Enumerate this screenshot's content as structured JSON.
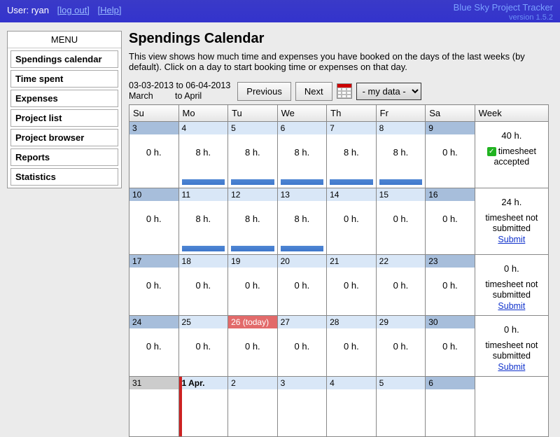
{
  "header": {
    "user_label": "User:",
    "user_name": "ryan",
    "logout": "[log out]",
    "help": "[Help]",
    "app_name": "Blue Sky Project Tracker",
    "version": "version 1.5.2"
  },
  "sidebar": {
    "title": "MENU",
    "items": [
      "Spendings calendar",
      "Time spent",
      "Expenses",
      "Project list",
      "Project browser",
      "Reports",
      "Statistics"
    ]
  },
  "page": {
    "title": "Spendings Calendar",
    "desc": "This view shows how much time and expenses you have booked on the days of the last weeks (by default). Click on a day to start booking time or expenses on that day.",
    "date_from": "03-03-2013",
    "date_to": "to 06-04-2013",
    "month_from": "March",
    "month_to": "to April",
    "prev_btn": "Previous",
    "next_btn": "Next",
    "selector": "- my data -"
  },
  "calendar": {
    "day_headers": [
      "Su",
      "Mo",
      "Tu",
      "We",
      "Th",
      "Fr",
      "Sa",
      "Week"
    ],
    "weeks": [
      {
        "days": [
          {
            "num": "3",
            "hours": "0 h.",
            "weekend": true
          },
          {
            "num": "4",
            "hours": "8 h.",
            "bar": true
          },
          {
            "num": "5",
            "hours": "8 h.",
            "bar": true
          },
          {
            "num": "6",
            "hours": "8 h.",
            "bar": true
          },
          {
            "num": "7",
            "hours": "8 h.",
            "bar": true
          },
          {
            "num": "8",
            "hours": "8 h.",
            "bar": true
          },
          {
            "num": "9",
            "hours": "0 h.",
            "weekend": true
          }
        ],
        "summary": {
          "hours": "40 h.",
          "status": "timesheet accepted",
          "accepted": true
        }
      },
      {
        "days": [
          {
            "num": "10",
            "hours": "0 h.",
            "weekend": true
          },
          {
            "num": "11",
            "hours": "8 h.",
            "bar": true
          },
          {
            "num": "12",
            "hours": "8 h.",
            "bar": true
          },
          {
            "num": "13",
            "hours": "8 h.",
            "bar": true
          },
          {
            "num": "14",
            "hours": "0 h."
          },
          {
            "num": "15",
            "hours": "0 h."
          },
          {
            "num": "16",
            "hours": "0 h.",
            "weekend": true
          }
        ],
        "summary": {
          "hours": "24 h.",
          "status": "timesheet not submitted",
          "submit": true
        }
      },
      {
        "days": [
          {
            "num": "17",
            "hours": "0 h.",
            "weekend": true
          },
          {
            "num": "18",
            "hours": "0 h."
          },
          {
            "num": "19",
            "hours": "0 h."
          },
          {
            "num": "20",
            "hours": "0 h."
          },
          {
            "num": "21",
            "hours": "0 h."
          },
          {
            "num": "22",
            "hours": "0 h."
          },
          {
            "num": "23",
            "hours": "0 h.",
            "weekend": true
          }
        ],
        "summary": {
          "hours": "0 h.",
          "status": "timesheet not submitted",
          "submit": true
        }
      },
      {
        "days": [
          {
            "num": "24",
            "hours": "0 h.",
            "weekend": true
          },
          {
            "num": "25",
            "hours": "0 h."
          },
          {
            "num": "26 (today)",
            "hours": "0 h.",
            "today": true
          },
          {
            "num": "27",
            "hours": "0 h."
          },
          {
            "num": "28",
            "hours": "0 h."
          },
          {
            "num": "29",
            "hours": "0 h."
          },
          {
            "num": "30",
            "hours": "0 h.",
            "weekend": true
          }
        ],
        "summary": {
          "hours": "0 h.",
          "status": "timesheet not submitted",
          "submit": true
        }
      },
      {
        "days": [
          {
            "num": "31",
            "hours": "",
            "weekend": true,
            "other": true
          },
          {
            "num": "1 Apr.",
            "hours": "",
            "redtick": true,
            "bold": true
          },
          {
            "num": "2",
            "hours": ""
          },
          {
            "num": "3",
            "hours": ""
          },
          {
            "num": "4",
            "hours": ""
          },
          {
            "num": "5",
            "hours": ""
          },
          {
            "num": "6",
            "hours": ""
          }
        ],
        "summary": {
          "hours": "",
          "status": ""
        }
      }
    ],
    "submit_label": "Submit"
  }
}
